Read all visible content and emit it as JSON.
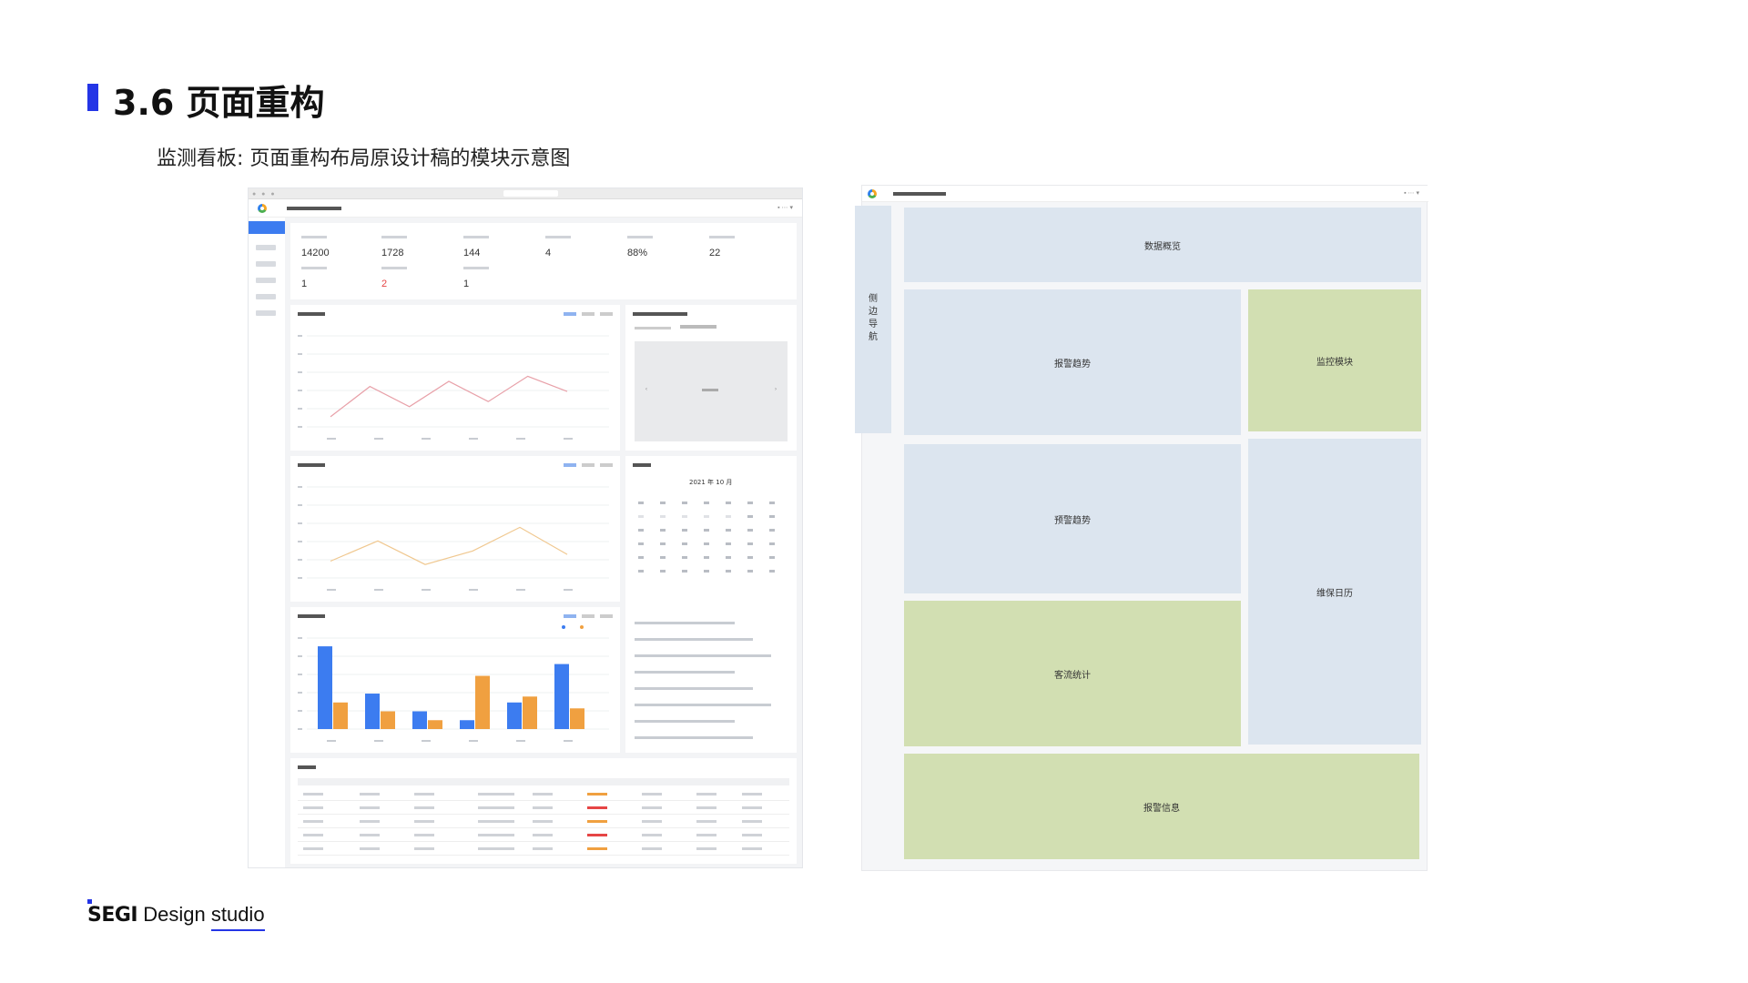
{
  "slide": {
    "title": "3.6 页面重构",
    "subtitle": "监测看板: 页面重构布局原设计稿的模块示意图"
  },
  "mock": {
    "kpis": [
      {
        "value": "14200"
      },
      {
        "value": "1728"
      },
      {
        "value": "144"
      },
      {
        "value": "4"
      },
      {
        "value": "88%"
      },
      {
        "value": "22"
      },
      {
        "value": "1"
      },
      {
        "value": "2",
        "highlight": true
      },
      {
        "value": "1"
      }
    ],
    "calendar": {
      "month_label": "2021 年 10 月"
    },
    "charts": [
      {
        "type": "line",
        "color": "#e8a0a8",
        "values": [
          2,
          8,
          4,
          9,
          5,
          10,
          7
        ]
      },
      {
        "type": "line",
        "color": "#f0c890",
        "values": [
          10,
          22,
          8,
          16,
          30,
          14
        ]
      },
      {
        "type": "bar",
        "colors": [
          "#3c7cf0",
          "#f0a040"
        ],
        "series_a": [
          28,
          12,
          6,
          3,
          9,
          22
        ],
        "series_b": [
          9,
          6,
          3,
          18,
          11,
          7
        ]
      }
    ]
  },
  "wireframe": {
    "nav_label": "侧边导航",
    "blocks": {
      "data_overview": "数据概览",
      "alarm_trend": "报警趋势",
      "monitor_module": "监控模块",
      "warning_trend": "预警趋势",
      "maintenance_calendar": "维保日历",
      "traffic_stats": "客流统计",
      "alarm_info": "报警信息"
    }
  },
  "footer": {
    "brand_bold": "SEGI",
    "brand_design": "Design ",
    "brand_studio": "studio"
  },
  "colors": {
    "accent": "#2435e6",
    "block_blue": "#dce5ef",
    "block_green": "#d2dfb2"
  }
}
